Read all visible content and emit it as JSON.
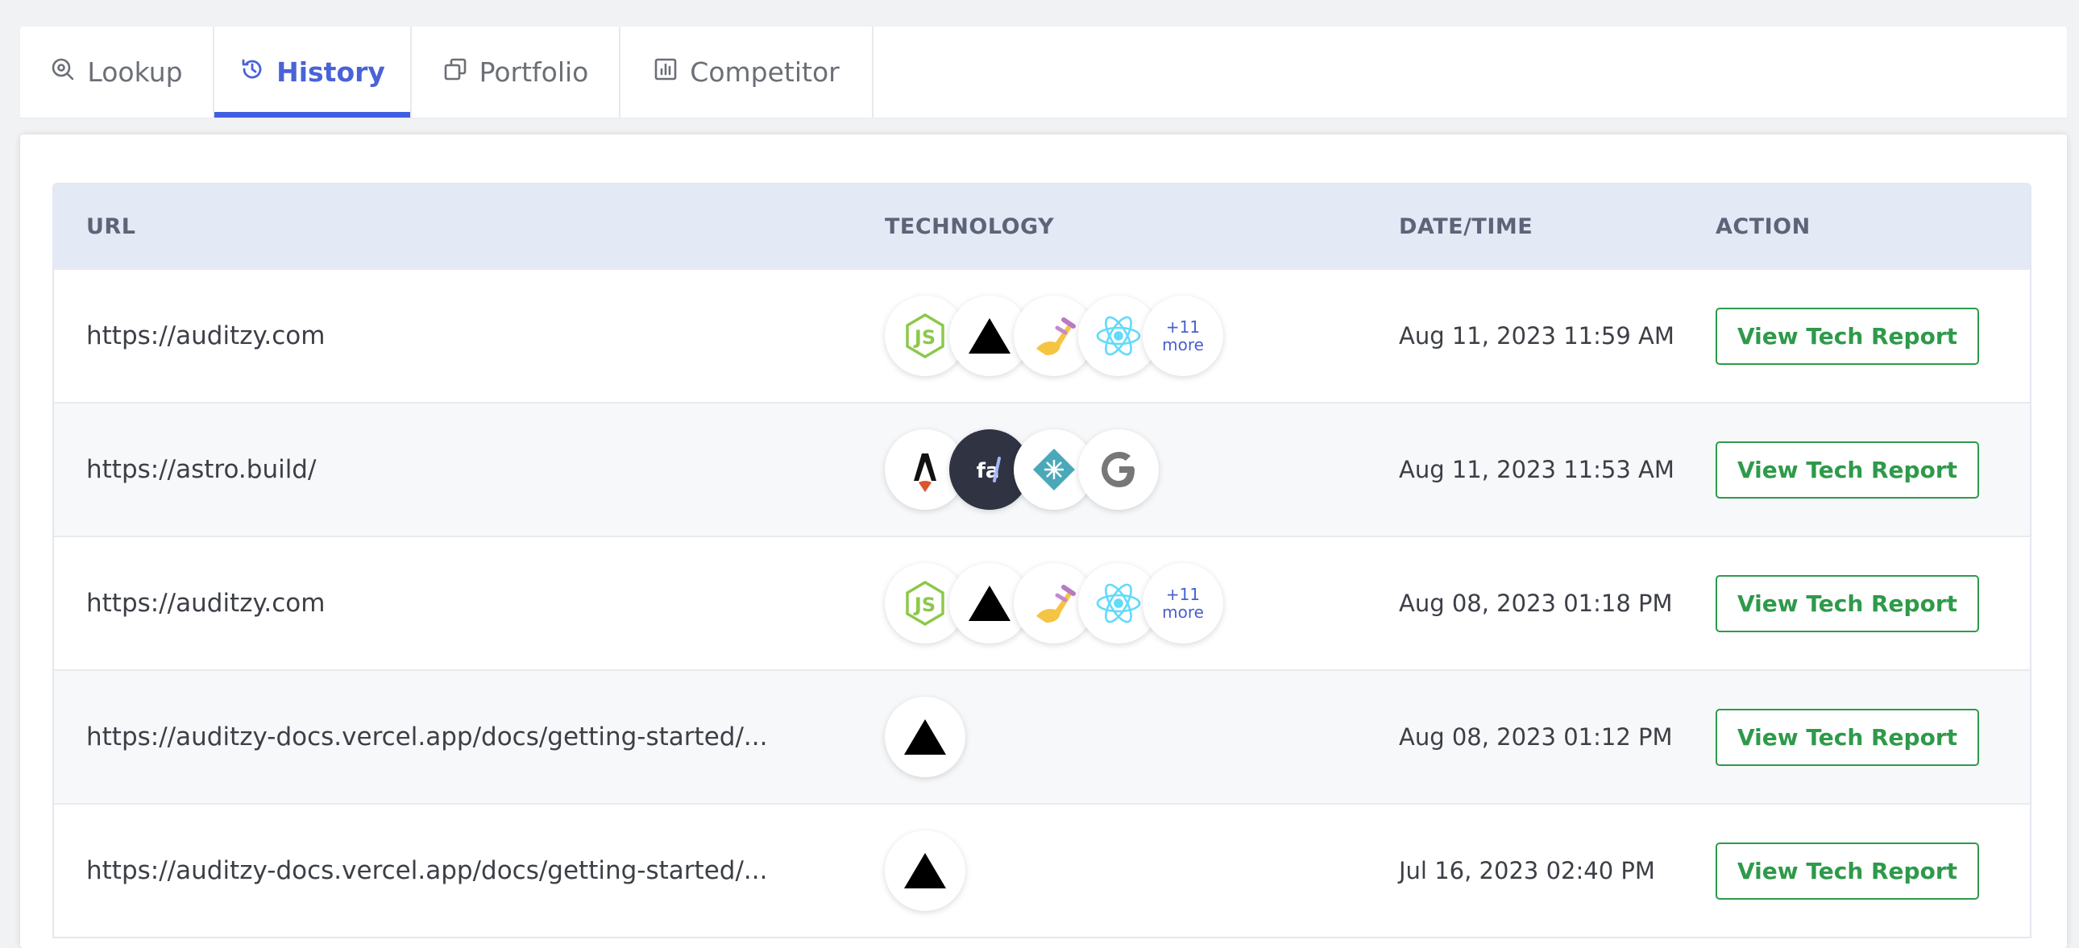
{
  "tabs": [
    {
      "label": "Lookup",
      "icon": "search-icon",
      "active": false
    },
    {
      "label": "History",
      "icon": "history-icon",
      "active": true
    },
    {
      "label": "Portfolio",
      "icon": "portfolio-icon",
      "active": false
    },
    {
      "label": "Competitor",
      "icon": "chart-icon",
      "active": false
    }
  ],
  "table": {
    "headers": {
      "url": "URL",
      "technology": "TECHNOLOGY",
      "datetime": "DATE/TIME",
      "action": "ACTION"
    },
    "rows": [
      {
        "url": "https://auditzy.com",
        "technologies": [
          "nodejs-icon",
          "vercel-icon",
          "styled-components-icon",
          "react-icon"
        ],
        "more": "+11",
        "more_label": "more",
        "datetime": "Aug 11, 2023 11:59 AM",
        "action": "View Tech Report"
      },
      {
        "url": "https://astro.build/",
        "technologies": [
          "astro-icon",
          "font-awesome-icon",
          "netlify-icon",
          "google-icon"
        ],
        "datetime": "Aug 11, 2023 11:53 AM",
        "action": "View Tech Report"
      },
      {
        "url": "https://auditzy.com",
        "technologies": [
          "nodejs-icon",
          "vercel-icon",
          "styled-components-icon",
          "react-icon"
        ],
        "more": "+11",
        "more_label": "more",
        "datetime": "Aug 08, 2023 01:18 PM",
        "action": "View Tech Report"
      },
      {
        "url": "https://auditzy-docs.vercel.app/docs/getting-started/...",
        "technologies": [
          "vercel-icon"
        ],
        "datetime": "Aug 08, 2023 01:12 PM",
        "action": "View Tech Report"
      },
      {
        "url": "https://auditzy-docs.vercel.app/docs/getting-started/...",
        "technologies": [
          "vercel-icon"
        ],
        "datetime": "Jul 16, 2023 02:40 PM",
        "action": "View Tech Report"
      }
    ]
  },
  "colors": {
    "accent": "#3f5ee0",
    "action_green": "#2e9a4a",
    "header_bg": "#e3eaf5"
  }
}
